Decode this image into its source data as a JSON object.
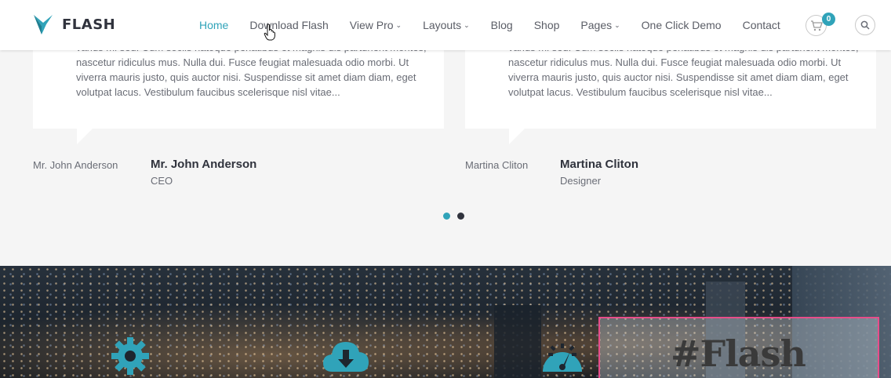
{
  "brand": {
    "name": "FLASH",
    "accent": "#30a3b9"
  },
  "nav": {
    "items": [
      {
        "label": "Home",
        "caret": false,
        "active": true
      },
      {
        "label": "Download Flash",
        "caret": false,
        "active": false
      },
      {
        "label": "View Pro",
        "caret": true,
        "active": false
      },
      {
        "label": "Layouts",
        "caret": true,
        "active": false
      },
      {
        "label": "Blog",
        "caret": false,
        "active": false
      },
      {
        "label": "Shop",
        "caret": false,
        "active": false
      },
      {
        "label": "Pages",
        "caret": true,
        "active": false
      },
      {
        "label": "One Click Demo",
        "caret": false,
        "active": false
      },
      {
        "label": "Contact",
        "caret": false,
        "active": false
      }
    ],
    "cart_count": "0",
    "caret_glyph": "⌄"
  },
  "testimonials": [
    {
      "text": "varius mi sed. Cum sociis natoque penatibus et magnis dis parturient montes, nascetur ridiculus mus. Nulla dui. Fusce feugiat malesuada odio morbi. Ut viverra mauris justo, quis auctor nisi. Suspendisse sit amet diam diam, eget volutpat lacus. Vestibulum faucibus scelerisque nisl vitae...",
      "image_alt": "Mr. John Anderson",
      "name": "Mr. John Anderson",
      "role": "CEO"
    },
    {
      "text": "varius mi sed. Cum sociis natoque penatibus et magnis dis parturient montes, nascetur ridiculus mus. Nulla dui. Fusce feugiat malesuada odio morbi. Ut viverra mauris justo, quis auctor nisi. Suspendisse sit amet diam diam, eget volutpat lacus. Vestibulum faucibus scelerisque nisl vitae...",
      "image_alt": "Martina Cliton",
      "name": "Martina Cliton",
      "role": "Designer"
    }
  ],
  "carousel": {
    "active_index": 0,
    "count": 2
  },
  "banner": {
    "overlay_tag": "#Flash",
    "icons": [
      "gear-icon",
      "cloud-download-icon",
      "speedometer-icon"
    ],
    "highlight_color": "#e84d8a"
  }
}
